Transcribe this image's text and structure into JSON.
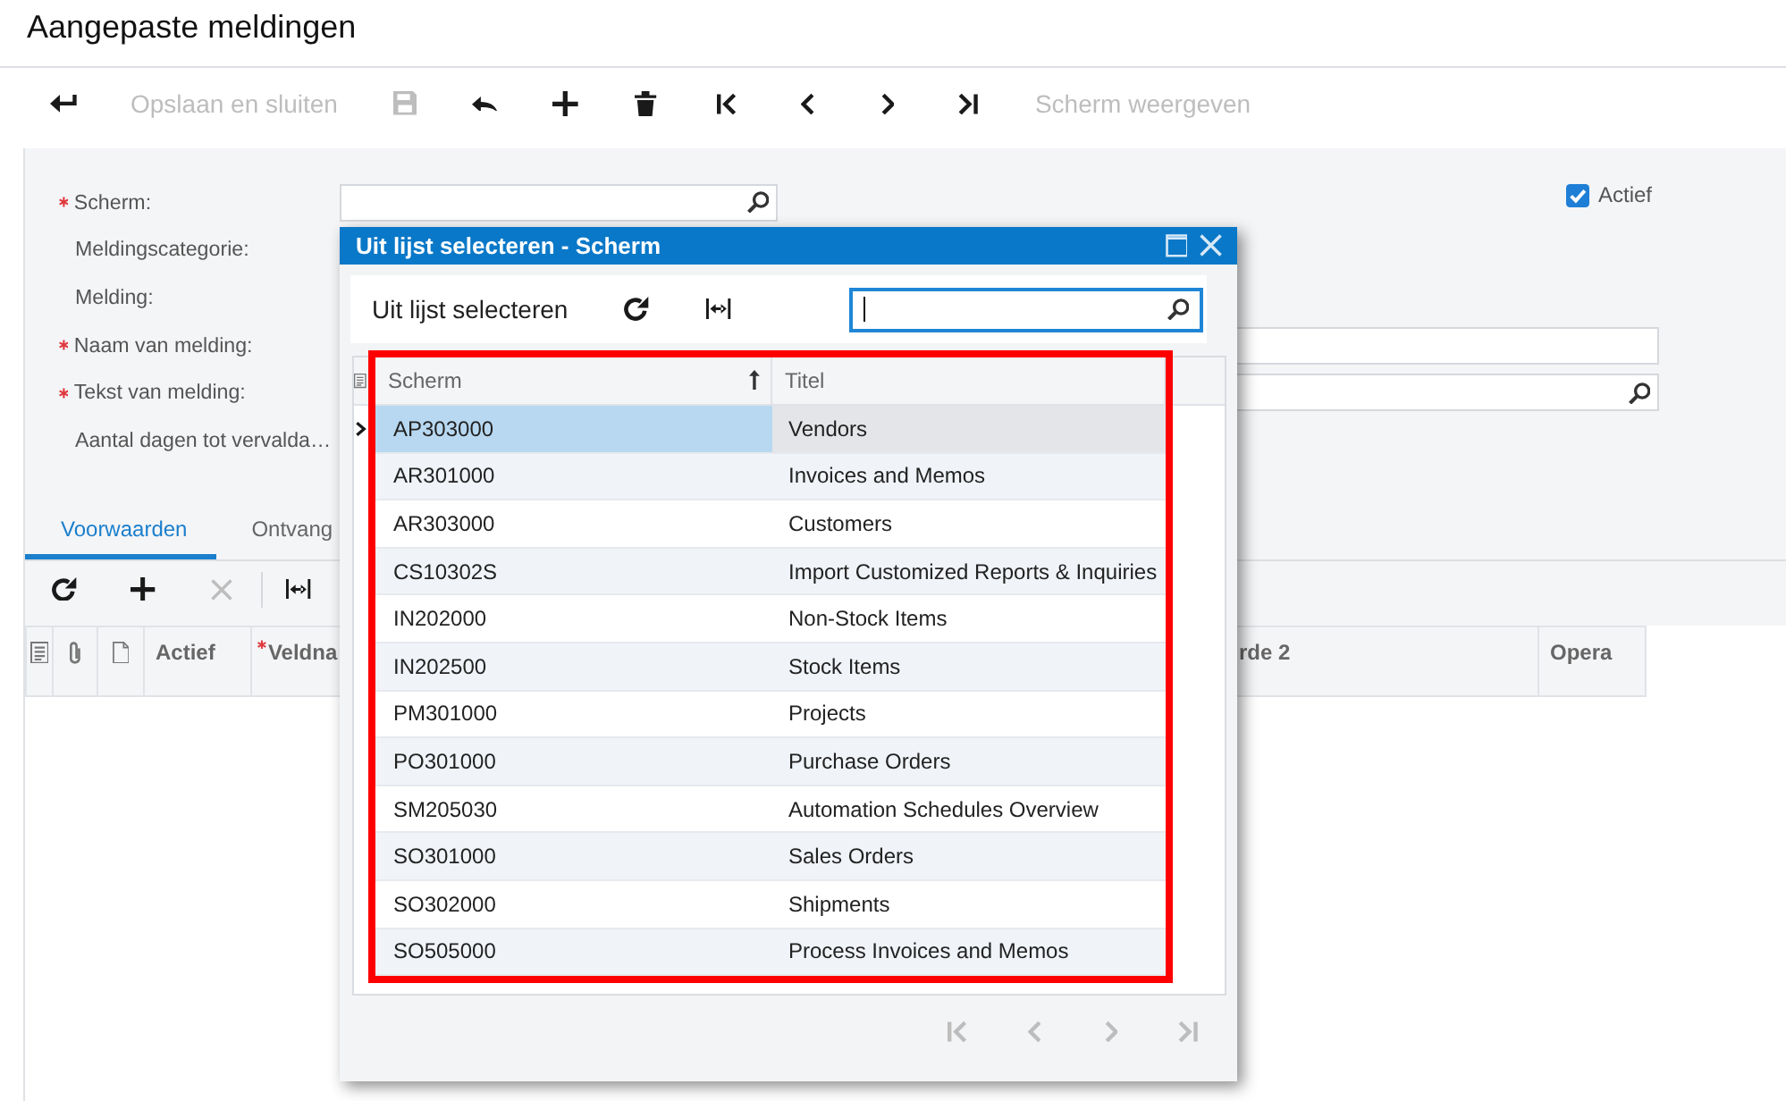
{
  "page": {
    "title": "Aangepaste meldingen"
  },
  "toolbar": [
    {
      "kind": "icon",
      "disabled": false
    },
    {
      "kind": "text",
      "label": "Opslaan en sluiten",
      "disabled": true
    },
    {
      "kind": "icon",
      "disabled": true
    },
    {
      "kind": "icon",
      "disabled": false
    },
    {
      "kind": "icon",
      "disabled": false
    },
    {
      "kind": "icon",
      "disabled": false
    },
    {
      "kind": "icon",
      "disabled": false
    },
    {
      "kind": "icon",
      "disabled": false
    },
    {
      "kind": "icon",
      "disabled": false
    },
    {
      "kind": "icon",
      "disabled": false
    },
    {
      "kind": "text",
      "label": "Scherm weergeven",
      "disabled": true
    }
  ],
  "form": {
    "fields": [
      {
        "label": "Scherm:",
        "required": true,
        "kind": "selector"
      },
      {
        "label": "Meldingscategorie:",
        "required": false,
        "kind": "label"
      },
      {
        "label": "Melding:",
        "required": false,
        "kind": "label"
      },
      {
        "label": "Naam van melding:",
        "required": true,
        "kind": "text"
      },
      {
        "label": "Tekst van melding:",
        "required": true,
        "kind": "lookup"
      },
      {
        "label": "Aantal dagen tot vervalda…",
        "required": false,
        "kind": "label"
      }
    ],
    "active": {
      "label": "Actief",
      "checked": true
    }
  },
  "tabs": [
    {
      "label": "Voorwaarden",
      "selected": true
    },
    {
      "label": "Ontvang",
      "selected": false
    }
  ],
  "grid": {
    "toolbar": [
      {
        "disabled": false
      },
      {
        "disabled": false
      },
      {
        "disabled": true
      },
      {
        "disabled": false
      }
    ],
    "columns": [
      {
        "kind": "icon"
      },
      {
        "kind": "icon"
      },
      {
        "kind": "icon"
      },
      {
        "kind": "text",
        "label": "Actief",
        "required": false
      },
      {
        "kind": "text",
        "label": "Veldna",
        "required": true
      },
      {
        "kind": "text",
        "label": "rde 2",
        "required": false
      },
      {
        "kind": "text",
        "label": "Opera",
        "required": false
      }
    ]
  },
  "dialog": {
    "title": "Uit lijst selecteren - Scherm",
    "toolbar_label": "Uit lijst selecteren",
    "search": {
      "focused": true
    },
    "highlighted": true,
    "columns": [
      {
        "label": "Scherm",
        "sorted": true
      },
      {
        "label": "Titel",
        "sorted": false
      }
    ],
    "rows": [
      {
        "selected": true,
        "cells": [
          "AP303000",
          "Vendors"
        ]
      },
      {
        "selected": false,
        "cells": [
          "AR301000",
          "Invoices and Memos"
        ]
      },
      {
        "selected": false,
        "cells": [
          "AR303000",
          "Customers"
        ]
      },
      {
        "selected": false,
        "cells": [
          "CS10302S",
          "Import Customized Reports & Inquiries"
        ]
      },
      {
        "selected": false,
        "cells": [
          "IN202000",
          "Non-Stock Items"
        ]
      },
      {
        "selected": false,
        "cells": [
          "IN202500",
          "Stock Items"
        ]
      },
      {
        "selected": false,
        "cells": [
          "PM301000",
          "Projects"
        ]
      },
      {
        "selected": false,
        "cells": [
          "PO301000",
          "Purchase Orders"
        ]
      },
      {
        "selected": false,
        "cells": [
          "SM205030",
          "Automation Schedules Overview"
        ]
      },
      {
        "selected": false,
        "cells": [
          "SO301000",
          "Sales Orders"
        ]
      },
      {
        "selected": false,
        "cells": [
          "SO302000",
          "Shipments"
        ]
      },
      {
        "selected": false,
        "cells": [
          "SO505000",
          "Process Invoices and Memos"
        ]
      }
    ],
    "pager": [
      {
        "disabled": true
      },
      {
        "disabled": true
      },
      {
        "disabled": true
      },
      {
        "disabled": true
      }
    ]
  }
}
